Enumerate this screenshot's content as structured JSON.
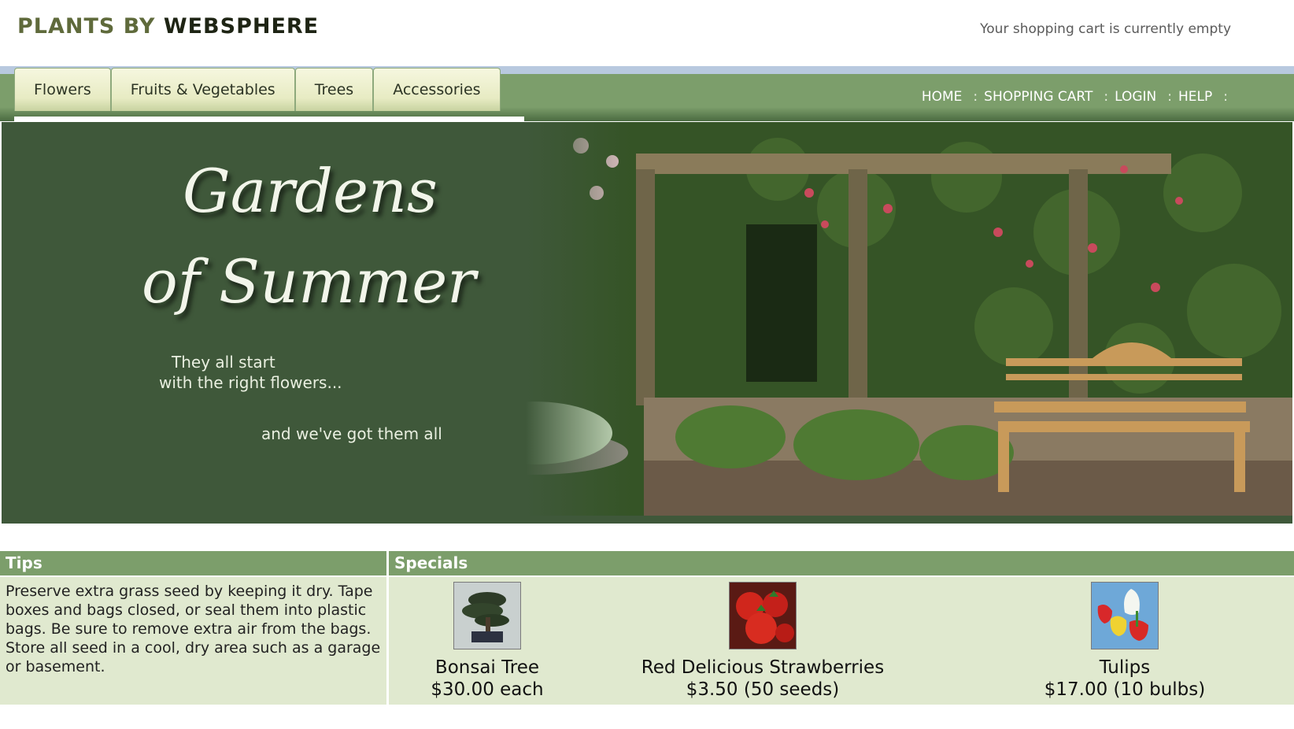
{
  "header": {
    "logo_part1": "PLANTS BY ",
    "logo_part2": "WEBSPHERE",
    "cart_status": "Your shopping cart is currently empty"
  },
  "nav": {
    "tabs": [
      {
        "label": "Flowers"
      },
      {
        "label": "Fruits & Vegetables"
      },
      {
        "label": "Trees"
      },
      {
        "label": "Accessories"
      }
    ],
    "links": [
      {
        "label": "HOME"
      },
      {
        "label": "SHOPPING CART"
      },
      {
        "label": "LOGIN"
      },
      {
        "label": "HELP"
      }
    ],
    "separator": ":"
  },
  "hero": {
    "title_line1": "Gardens",
    "title_line2": "of Summer",
    "tagline_line1": "They all start",
    "tagline_line2": "with the right flowers...",
    "tagline2": "and we've got them all"
  },
  "tips": {
    "heading": "Tips",
    "text": "Preserve extra grass seed by keeping it dry. Tape boxes and bags closed, or seal them into plastic bags. Be sure to remove extra air from the bags. Store all seed in a cool, dry area such as a garage or basement."
  },
  "specials": {
    "heading": "Specials",
    "items": [
      {
        "name": "Bonsai Tree",
        "price": "$30.00 each",
        "image": "bonsai-tree-image"
      },
      {
        "name": "Red Delicious Strawberries",
        "price": "$3.50 (50 seeds)",
        "image": "strawberries-image"
      },
      {
        "name": "Tulips",
        "price": "$17.00 (10 bulbs)",
        "image": "tulips-image"
      }
    ]
  },
  "colors": {
    "nav_green": "#7c9e6b",
    "hero_green": "#3f583a",
    "panel_bg": "#e0e9cf",
    "tab_bg": "#eef0d0"
  }
}
